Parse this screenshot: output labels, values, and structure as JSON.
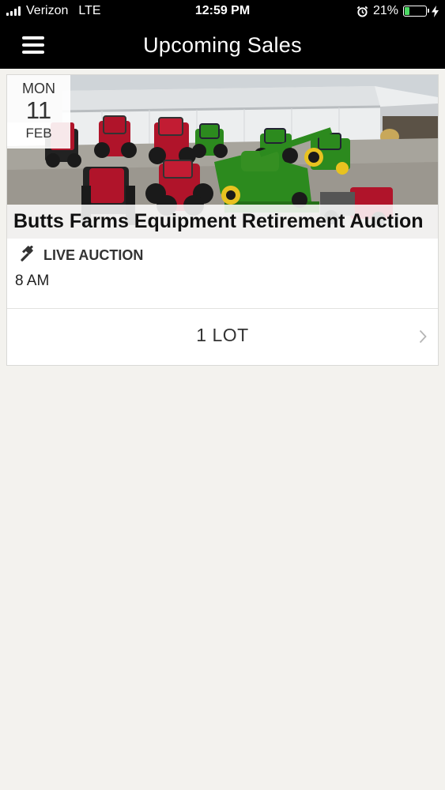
{
  "status_bar": {
    "carrier": "Verizon",
    "network": "LTE",
    "time": "12:59 PM",
    "battery_percent": "21%",
    "battery_level": 0.21,
    "battery_color": "#4cd964"
  },
  "header": {
    "title": "Upcoming Sales",
    "menu_icon": "hamburger-menu-icon"
  },
  "sales": [
    {
      "date": {
        "weekday": "MON",
        "day": "11",
        "month": "FEB"
      },
      "title": "Butts Farms Equipment Retirement Auction",
      "type_icon": "gavel-icon",
      "type": "LIVE AUCTION",
      "time": "8 AM",
      "lots_label": "1 LOT",
      "chevron_icon": "chevron-right-icon"
    }
  ],
  "colors": {
    "nav_background": "#000000",
    "page_background": "#f3f2ee",
    "tractor_red": "#b0142a",
    "tractor_green": "#2c8a1e"
  }
}
